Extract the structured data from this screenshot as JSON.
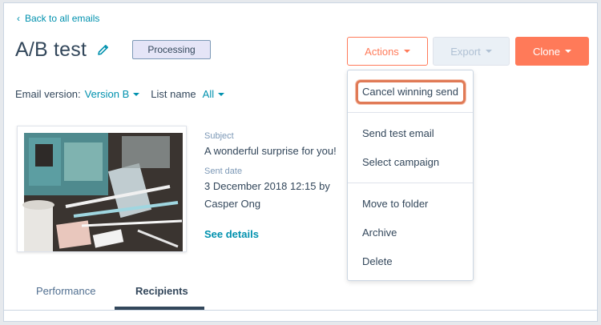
{
  "nav": {
    "back_label": "Back to all emails"
  },
  "header": {
    "title": "A/B test",
    "status": "Processing",
    "actions_label": "Actions",
    "export_label": "Export",
    "clone_label": "Clone"
  },
  "filters": {
    "email_version_label": "Email version:",
    "email_version_value": "Version B",
    "list_name_label": "List name",
    "list_name_value": "All"
  },
  "details": {
    "subject_label": "Subject",
    "subject_value": "A wonderful surprise for you!",
    "sent_date_label": "Sent date",
    "sent_date_line1": "3 December 2018 12:15 by",
    "sent_date_line2": "Casper Ong",
    "see_details": "See details"
  },
  "tabs": [
    {
      "label": "Performance",
      "active": false
    },
    {
      "label": "Recipients",
      "active": true
    }
  ],
  "actions_menu": [
    {
      "label": "Cancel winning send",
      "highlighted": true
    },
    {
      "label": "Send test email"
    },
    {
      "label": "Select campaign"
    },
    {
      "label": "Move to folder"
    },
    {
      "label": "Archive"
    },
    {
      "label": "Delete"
    }
  ],
  "colors": {
    "accent": "#ff7a59",
    "link": "#0091ae",
    "text": "#33475b",
    "highlight_outline": "#e07a56"
  }
}
